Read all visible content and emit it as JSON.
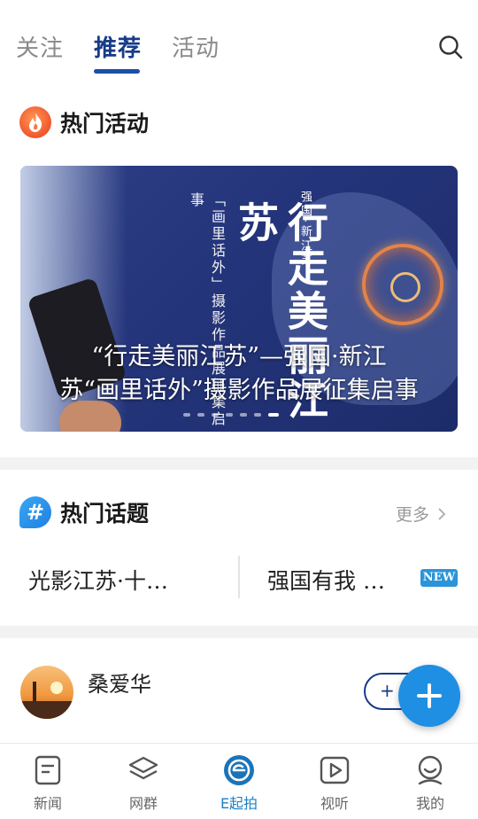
{
  "top_tabs": [
    {
      "label": "关注",
      "active": false
    },
    {
      "label": "推荐",
      "active": true
    },
    {
      "label": "活动",
      "active": false
    }
  ],
  "search_icon": "search-icon",
  "hot_activities": {
    "title": "热门活动",
    "icon": "fire-icon",
    "banner": {
      "caption_line1": "“行走美丽江苏”—强国·新江",
      "caption_line2": "苏“画里话外”摄影作品展征集启事",
      "vertical_big": "行走美丽江苏",
      "vertical_small": "「画里话外」摄影作品展征集启事",
      "vertical_tiny": "强国·新江苏",
      "page_count": 7,
      "active_page": 7
    }
  },
  "hot_topics": {
    "title": "热门话题",
    "icon": "hash-icon",
    "more_label": "更多",
    "topics": [
      {
        "label": "光影江苏·十…",
        "badge": ""
      },
      {
        "label": "强国有我 …",
        "badge": "NEW"
      }
    ]
  },
  "post": {
    "user_name": "桑爱华",
    "follow_label": "+",
    "fab_icon": "plus-icon"
  },
  "bottom_nav": [
    {
      "label": "新闻",
      "icon": "news-icon",
      "active": false
    },
    {
      "label": "网群",
      "icon": "layers-icon",
      "active": false
    },
    {
      "label": "E起拍",
      "icon": "e-camera-icon",
      "active": true
    },
    {
      "label": "视听",
      "icon": "play-icon",
      "active": false
    },
    {
      "label": "我的",
      "icon": "profile-icon",
      "active": false
    }
  ],
  "colors": {
    "primary": "#163b87",
    "accent_blue": "#1e8fe3",
    "fire": "#f0552b",
    "badge_new": "#2a95d8"
  }
}
